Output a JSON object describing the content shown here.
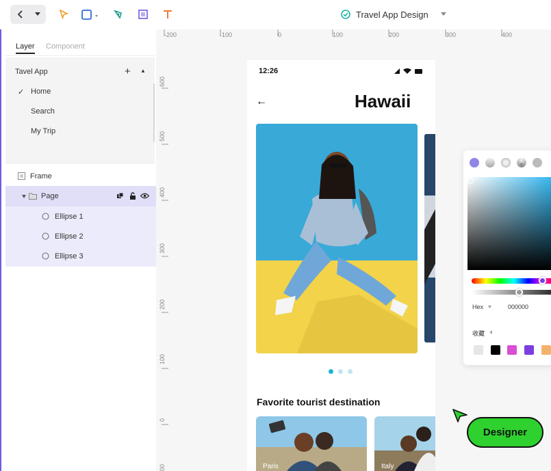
{
  "document": {
    "title": "Travel App Design"
  },
  "toolbar": {
    "tools": [
      "back-icon",
      "dropdown-icon",
      "select-arrow-icon",
      "rectangle-icon",
      "pen-icon",
      "frame-icon",
      "text-icon"
    ]
  },
  "left_panel": {
    "tabs": [
      {
        "label": "Layer",
        "active": true
      },
      {
        "label": "Component",
        "active": false
      }
    ],
    "project": {
      "label": "Tavel App",
      "add_symbol": "+",
      "collapse_symbol": "▲"
    },
    "pages": [
      {
        "label": "Home",
        "checked": true,
        "check": "✓"
      },
      {
        "label": "Search",
        "checked": false,
        "check": ""
      },
      {
        "label": "My Trip",
        "checked": false,
        "check": ""
      }
    ],
    "layers": {
      "frame": "Frame",
      "page": "Page",
      "ellipses": [
        "Ellipse 1",
        "Ellipse 2",
        "Ellipse 3"
      ]
    }
  },
  "rulers": {
    "top": [
      "-200",
      "-100",
      "0",
      "100",
      "200",
      "300",
      "400"
    ],
    "left": [
      "600",
      "500",
      "400",
      "300",
      "200",
      "100",
      "0",
      "00"
    ]
  },
  "phone": {
    "time": "12:26",
    "back_symbol": "←",
    "title": "Hawaii",
    "section_title": "Favorite tourist destination",
    "cards": [
      {
        "label": "Paris"
      },
      {
        "label": "Italy"
      }
    ]
  },
  "color_picker": {
    "hex_label": "Hex",
    "hex_value": "000000",
    "favorites_label": "收藏",
    "swatches": [
      "#e6e6e6",
      "#000000",
      "#d94fd3",
      "#7b3fe0",
      "#f3b26b"
    ]
  },
  "designer_tag": {
    "label": "Designer",
    "color": "#2ed12e"
  },
  "colors": {
    "accent": "#6b5ce7",
    "toolbar_icon": "#f0a030"
  }
}
